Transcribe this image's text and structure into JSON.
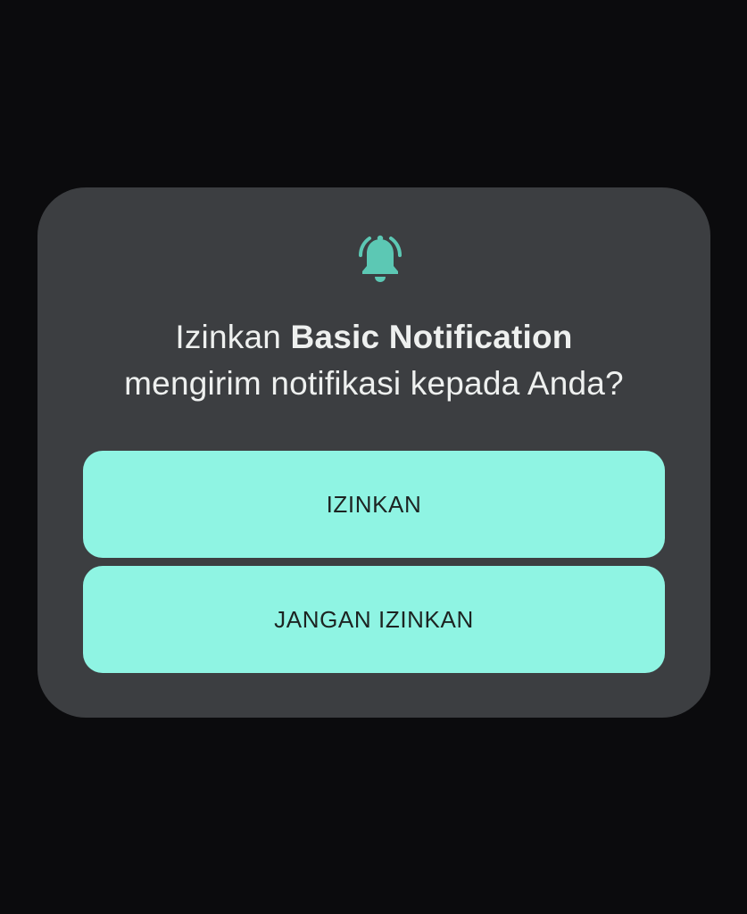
{
  "colors": {
    "background": "#0b0b0d",
    "dialog": "#3c3e41",
    "accent": "#5cc8b4",
    "button": "#8ff4e3",
    "button_text": "#1d2422",
    "title_text": "#eef0ef"
  },
  "dialog": {
    "icon": "bell-ringing-icon",
    "title_prefix": "Izinkan ",
    "app_name": "Basic Notification",
    "title_suffix": "mengirim notifikasi kepada Anda?",
    "buttons": {
      "allow": "IZINKAN",
      "deny": "JANGAN IZINKAN"
    }
  }
}
